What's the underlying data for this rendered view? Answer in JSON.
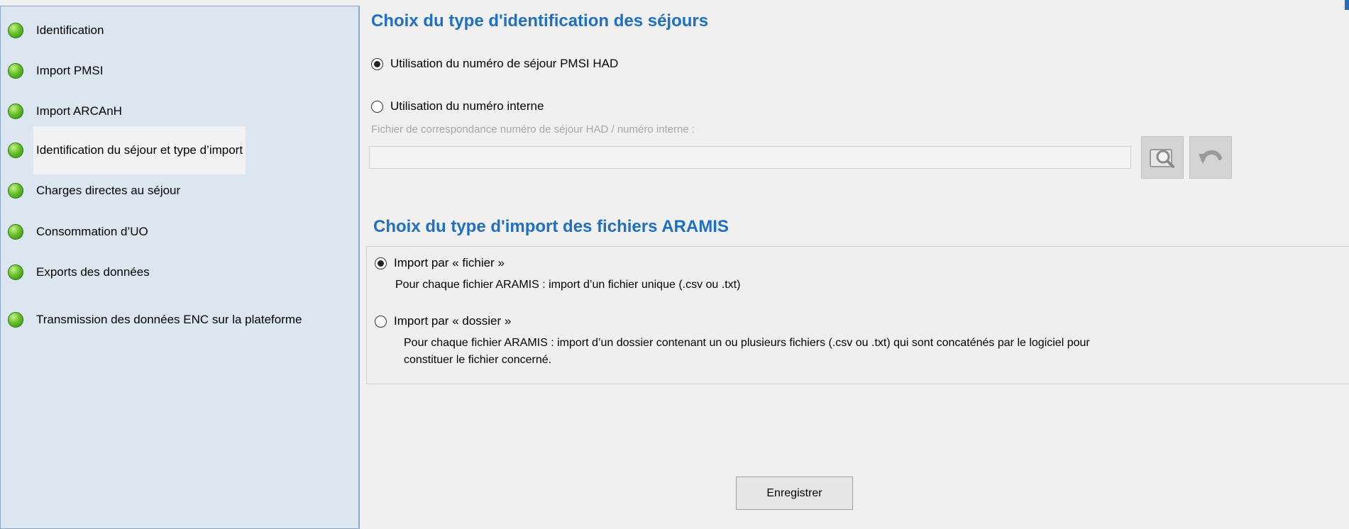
{
  "sidebar": {
    "items": [
      {
        "label": "Identification"
      },
      {
        "label": "Import PMSI"
      },
      {
        "label": "Import ARCAnH"
      },
      {
        "label": "Identification du séjour et type d’import"
      },
      {
        "label": "Charges directes au séjour"
      },
      {
        "label": "Consommation d’UO"
      },
      {
        "label": "Exports des données"
      },
      {
        "label": "Transmission des données ENC sur la plateforme"
      }
    ],
    "active_index": 3,
    "status_color": "#5cb82a"
  },
  "identification": {
    "title": "Choix du type d'identification des séjours",
    "option_pmsi": "Utilisation du numéro de séjour PMSI HAD",
    "option_internal": "Utilisation du numéro interne",
    "file_label": "Fichier de correspondance numéro de séjour HAD / numéro interne :",
    "file_value": "",
    "selected": "option_pmsi"
  },
  "import_type": {
    "title": "Choix du type d'import des fichiers ARAMIS",
    "option_file": "Import par « fichier »",
    "option_file_desc": "Pour chaque fichier ARAMIS : import d’un fichier unique (.csv ou .txt)",
    "option_folder": "Import par « dossier »",
    "option_folder_desc_1": "Pour chaque fichier ARAMIS : import d’un dossier contenant un ou plusieurs fichiers (.csv ou .txt) qui sont concaténés par le logiciel pour",
    "option_folder_desc_2": "constituer le fichier concerné.",
    "selected": "option_file"
  },
  "actions": {
    "save_label": "Enregistrer"
  },
  "colors": {
    "accent": "#1f6fc4",
    "sidebar_bg": "#dce6f1"
  },
  "icons": {
    "browse": "magnifier-folder-icon",
    "reset": "undo-arrow-icon"
  }
}
